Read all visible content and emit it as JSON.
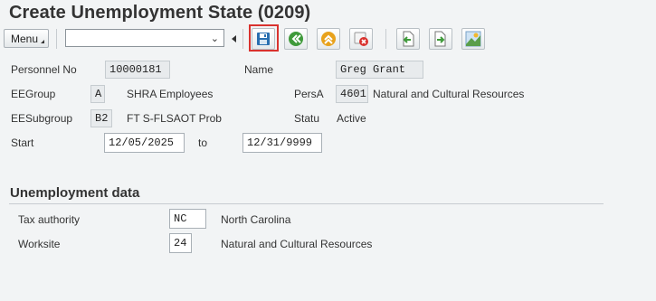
{
  "window": {
    "title": "Create Unemployment State (0209)"
  },
  "toolbar": {
    "menu_label": "Menu",
    "command_value": "",
    "buttons": [
      {
        "name": "save-icon"
      },
      {
        "name": "back-icon"
      },
      {
        "name": "exit-icon"
      },
      {
        "name": "cancel-icon"
      },
      {
        "name": "previous-record-icon"
      },
      {
        "name": "next-record-icon"
      },
      {
        "name": "overview-icon"
      }
    ]
  },
  "header": {
    "personnel_no_label": "Personnel No",
    "personnel_no_value": "10000181",
    "name_label": "Name",
    "name_value": "Greg Grant",
    "eegroup_label": "EEGroup",
    "eegroup_value": "A",
    "eegroup_text": "SHRA Employees",
    "persa_label": "PersA",
    "persa_value": "4601",
    "persa_text": "Natural and Cultural Resources",
    "eesubgroup_label": "EESubgroup",
    "eesubgroup_value": "B2",
    "eesubgroup_text": "FT S-FLSAOT Prob",
    "status_label": "Statu",
    "status_value": "Active",
    "start_label": "Start",
    "start_value": "12/05/2025",
    "to_label": "to",
    "end_value": "12/31/9999"
  },
  "unemployment": {
    "section_title": "Unemployment data",
    "tax_authority_label": "Tax authority",
    "tax_authority_value": "NC",
    "tax_authority_text": "North Carolina",
    "worksite_label": "Worksite",
    "worksite_value": "24",
    "worksite_text": "Natural and Cultural Resources"
  },
  "colors": {
    "highlight": "#d9322e",
    "background": "#f2f4f5"
  }
}
